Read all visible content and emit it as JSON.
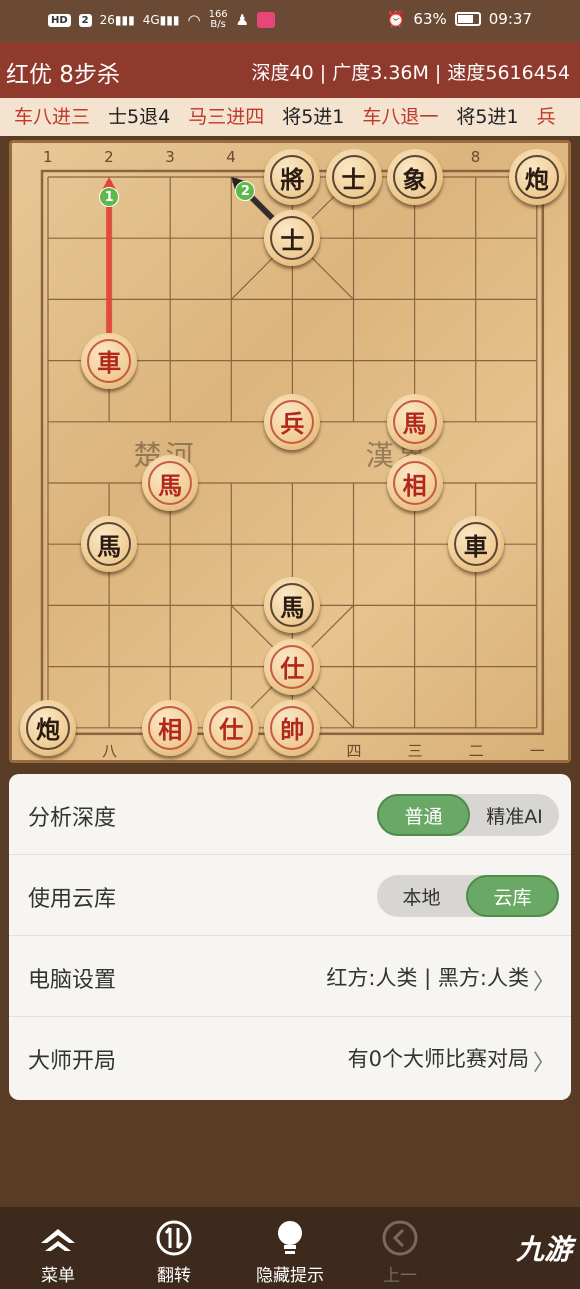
{
  "status": {
    "left_chips": [
      "HD",
      "2"
    ],
    "signal_1": "26",
    "signal_2": "4G",
    "net_speed_value": "166",
    "net_speed_unit": "B/s",
    "battery": "63%",
    "time": "09:37"
  },
  "title": {
    "left": "红优 8步杀",
    "right": "深度40 | 广度3.36M | 速度5616454"
  },
  "moves": [
    {
      "text": "车八进三",
      "side": "red"
    },
    {
      "text": "士5退4",
      "side": "black"
    },
    {
      "text": "马三进四",
      "side": "red"
    },
    {
      "text": "将5进1",
      "side": "black"
    },
    {
      "text": "车八退一",
      "side": "red"
    },
    {
      "text": "将5进1",
      "side": "black"
    },
    {
      "text": "兵",
      "side": "red"
    }
  ],
  "board": {
    "top_numbers": [
      "1",
      "2",
      "3",
      "4",
      "8"
    ],
    "bottom_numbers": [
      "八",
      "四",
      "三",
      "二",
      "一"
    ],
    "river_left": "楚河",
    "river_right": "漢界",
    "pieces": [
      {
        "char": "將",
        "side": "black",
        "file": 4,
        "rank": 0
      },
      {
        "char": "士",
        "side": "black",
        "file": 5,
        "rank": 0
      },
      {
        "char": "象",
        "side": "black",
        "file": 6,
        "rank": 0
      },
      {
        "char": "炮",
        "side": "black",
        "file": 8,
        "rank": 0
      },
      {
        "char": "士",
        "side": "black",
        "file": 4,
        "rank": 1
      },
      {
        "char": "車",
        "side": "red",
        "file": 1,
        "rank": 3
      },
      {
        "char": "兵",
        "side": "red",
        "file": 4,
        "rank": 4
      },
      {
        "char": "馬",
        "side": "red",
        "file": 6,
        "rank": 4
      },
      {
        "char": "馬",
        "side": "red",
        "file": 2,
        "rank": 5
      },
      {
        "char": "相",
        "side": "red",
        "file": 6,
        "rank": 5
      },
      {
        "char": "馬",
        "side": "black",
        "file": 1,
        "rank": 6
      },
      {
        "char": "車",
        "side": "black",
        "file": 7,
        "rank": 6
      },
      {
        "char": "馬",
        "side": "black",
        "file": 4,
        "rank": 7
      },
      {
        "char": "仕",
        "side": "red",
        "file": 4,
        "rank": 8
      },
      {
        "char": "炮",
        "side": "black",
        "file": 0,
        "rank": 9
      },
      {
        "char": "相",
        "side": "red",
        "file": 2,
        "rank": 9
      },
      {
        "char": "仕",
        "side": "red",
        "file": 3,
        "rank": 9
      },
      {
        "char": "帥",
        "side": "red",
        "file": 4,
        "rank": 9
      }
    ],
    "arrows": [
      {
        "label": "1",
        "color": "#e0453a",
        "from": [
          1,
          3
        ],
        "to": [
          1,
          0
        ]
      },
      {
        "label": "2",
        "color": "#222222",
        "from": [
          4,
          1
        ],
        "to": [
          3,
          0
        ]
      }
    ]
  },
  "settings": {
    "depth_label": "分析深度",
    "depth_options": [
      "普通",
      "精准AI"
    ],
    "depth_selected": 0,
    "cloud_label": "使用云库",
    "cloud_options": [
      "本地",
      "云库"
    ],
    "cloud_selected": 1,
    "computer_label": "电脑设置",
    "computer_value": "红方:人类 | 黑方:人类",
    "master_label": "大师开局",
    "master_value": "有0个大师比赛对局"
  },
  "nav": {
    "menu": "菜单",
    "flip": "翻转",
    "hide_hint": "隐藏提示",
    "prev": "上一"
  },
  "watermark": "九游"
}
